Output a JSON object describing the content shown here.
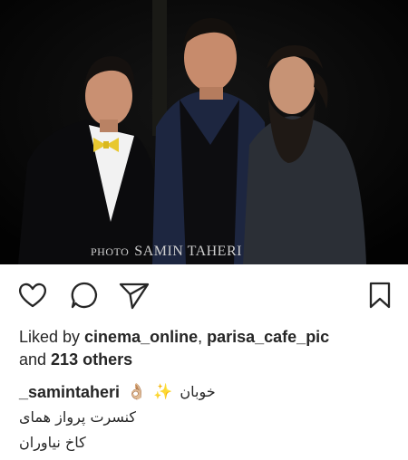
{
  "photo": {
    "watermark_small": "PHOTO",
    "watermark_large": "SAMIN TAHERI"
  },
  "actions": {
    "icons": [
      "heart-icon",
      "comment-icon",
      "share-icon",
      "bookmark-icon"
    ]
  },
  "likes": {
    "prefix": "Liked by ",
    "user1": "cinema_online",
    "sep": ", ",
    "user2": "parisa_cafe_pic",
    "middle": "and ",
    "others": "213 others"
  },
  "caption": {
    "username": "_samintaheri",
    "emoji_hand": "👌🏼",
    "emoji_sparkles": "✨",
    "line1_text": "خوبان",
    "line2_text": "کنسرت پرواز همای",
    "line3_text": "کاخ نیاوران"
  }
}
